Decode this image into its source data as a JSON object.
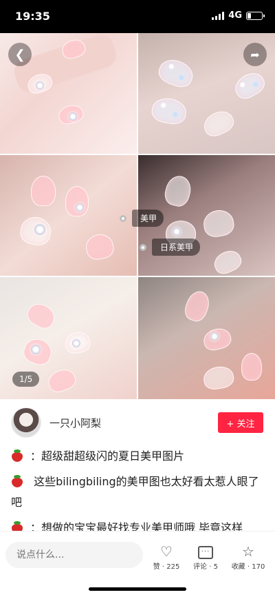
{
  "status_bar": {
    "time": "19:35",
    "network": "4G"
  },
  "gallery": {
    "counter": "1/5",
    "tags": [
      "美甲",
      "日系美甲"
    ]
  },
  "author": {
    "name": "一只小阿梨",
    "follow_label": "+ 关注"
  },
  "post": {
    "lines": [
      "：超级甜超级闪的夏日美甲图片",
      " 这些bilingbiling的美甲图也太好看太惹人眼了吧",
      "：想做的宝宝最好找专业美甲师哦 毕竟这样"
    ]
  },
  "bottom_bar": {
    "comment_placeholder": "说点什么...",
    "like_label": "赞 · 225",
    "comment_label": "评论 · 5",
    "collect_label": "收藏 · 170"
  },
  "icons": {
    "back": "chevron-left-icon",
    "share": "share-icon",
    "like": "heart-icon",
    "comment": "comment-icon",
    "collect": "star-icon",
    "emoji": "strawberry-icon"
  },
  "colors": {
    "accent": "#ff2442"
  }
}
